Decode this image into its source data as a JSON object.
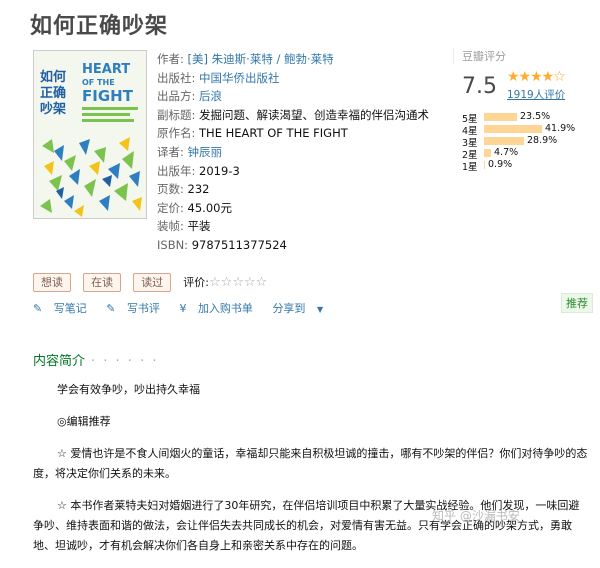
{
  "book": {
    "title": "如何正确吵架",
    "cover_text": {
      "cn_title": "如何正确吵架",
      "en_title_1": "THE HEART",
      "en_title_2": "OF THE",
      "en_title_3": "FIGHT"
    },
    "author_label": "作者:",
    "author": "[美] 朱迪斯·莱特 / 鲍勃·莱特",
    "publisher_label": "出版社:",
    "publisher": "中国华侨出版社",
    "producer_label": "出品方:",
    "producer": "后浪",
    "subtitle_label": "副标题:",
    "subtitle": "发掘问题、解读渴望、创造幸福的伴侣沟通术",
    "original_label": "原作名:",
    "original": "THE HEART OF THE FIGHT",
    "translator_label": "译者:",
    "translator": "钟辰丽",
    "year_label": "出版年:",
    "year": "2019-3",
    "pages_label": "页数:",
    "pages": "232",
    "price_label": "定价:",
    "price": "45.00元",
    "binding_label": "装帧:",
    "binding": "平装",
    "isbn_label": "ISBN:",
    "isbn": "9787511377524"
  },
  "rating": {
    "title": "豆瓣评分",
    "score": "7.5",
    "stars": "★★★★☆",
    "count_text": "1919人评价",
    "distribution": [
      {
        "label": "5星",
        "pct": "23.5%",
        "value": 23.5
      },
      {
        "label": "4星",
        "pct": "41.9%",
        "value": 41.9
      },
      {
        "label": "3星",
        "pct": "28.9%",
        "value": 28.9
      },
      {
        "label": "2星",
        "pct": "4.7%",
        "value": 4.7
      },
      {
        "label": "1星",
        "pct": "0.9%",
        "value": 0.9
      }
    ],
    "colors": {
      "star": "#ffac2d",
      "bar": "#ffd596"
    }
  },
  "actions": {
    "want": "想读",
    "reading": "在读",
    "read": "读过",
    "rate_label": "评价:",
    "rate_stars": "☆☆☆☆☆"
  },
  "links": {
    "note": "写笔记",
    "review": "写书评",
    "cart": "加入购书单",
    "share": "分享到",
    "recommend": "推荐"
  },
  "intro": {
    "heading": "内容简介",
    "dots": "· · · · · ·",
    "paragraphs": [
      "学会有效争吵，吵出持久幸福",
      "◎编辑推荐",
      "☆ 爱情也许是不食人间烟火的童话，幸福却只能来自积极坦诚的撞击，哪有不吵架的伴侣？你们对待争吵的态度，将决定你们关系的未来。",
      "☆ 本书作者莱特夫妇对婚姻进行了30年研究，在伴侣培训项目中积累了大量实战经验。他们发现，一味回避争吵、维持表面和谐的做法，会让伴侣失去共同成长的机会，对爱情有害无益。只有学会正确的吵架方式，勇敢地、坦诚吵，才有机会解决你们各自身上和亲密关系中存在的问题。"
    ]
  },
  "watermark": "知乎 @沙漏书安"
}
